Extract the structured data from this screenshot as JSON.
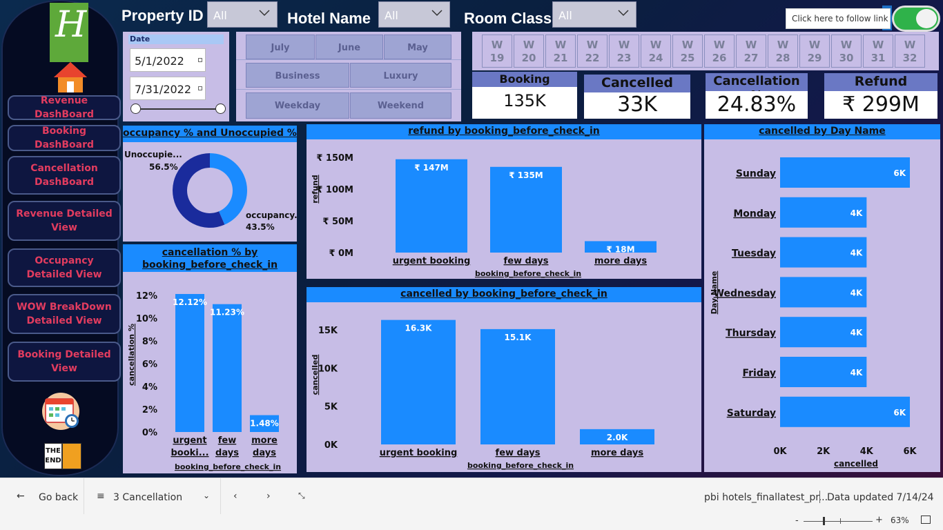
{
  "header": {
    "property_label": "Property ID",
    "property_value": "All",
    "hotel_label": "Hotel Name",
    "hotel_value": "All",
    "room_label": "Room Class",
    "room_value": "All",
    "follow_link_text": "Click here to follow link"
  },
  "sidebar": {
    "logo_letter": "H",
    "logo_icon": "holiday-inn-logo",
    "home_icon": "home-icon",
    "items": [
      {
        "label": "Revenue DashBoard"
      },
      {
        "label": "Booking DashBoard"
      },
      {
        "label": "Cancellation DashBoard"
      },
      {
        "label": "Revenue Detailed View"
      },
      {
        "label": "Occupancy Detailed View"
      },
      {
        "label": "WOW BreakDown Detailed View"
      },
      {
        "label": "Booking Detailed View"
      }
    ],
    "calendar_icon": "calendar-icon",
    "end_icon": "the-end-book-icon",
    "end_text_1": "THE",
    "end_text_2": "END"
  },
  "date_slicer": {
    "label": "Date",
    "start": "5/1/2022",
    "end": "7/31/2022"
  },
  "tiles": {
    "months": [
      "July",
      "June",
      "May"
    ],
    "room_types": [
      "Business",
      "Luxury"
    ],
    "day_types": [
      "Weekday",
      "Weekend"
    ]
  },
  "weeks": [
    {
      "w": "W",
      "n": "19"
    },
    {
      "w": "W",
      "n": "20"
    },
    {
      "w": "W",
      "n": "21"
    },
    {
      "w": "W",
      "n": "22"
    },
    {
      "w": "W",
      "n": "23"
    },
    {
      "w": "W",
      "n": "24"
    },
    {
      "w": "W",
      "n": "25"
    },
    {
      "w": "W",
      "n": "26"
    },
    {
      "w": "W",
      "n": "27"
    },
    {
      "w": "W",
      "n": "28"
    },
    {
      "w": "W",
      "n": "29"
    },
    {
      "w": "W",
      "n": "30"
    },
    {
      "w": "W",
      "n": "31"
    },
    {
      "w": "W",
      "n": "32"
    }
  ],
  "kpis": {
    "booking_label": "Booking",
    "booking_value": "135K",
    "cancelled_label": "Cancelled",
    "cancelled_value": "33K",
    "cancel_pct_label": "Cancellation %",
    "cancel_pct_value": "24.83%",
    "refund_label": "Refund",
    "refund_value": "₹ 299M"
  },
  "colors": {
    "bar": "#1a8bff",
    "donut_dark": "#1a2b9c",
    "donut_light": "#1a8bff",
    "panel": "#c7bde6",
    "nav_text": "#e23c5f"
  },
  "chart_data": [
    {
      "id": "occupancy",
      "type": "pie",
      "title": "occupancy % and Unoccupied %",
      "slices": [
        {
          "label": "Unoccupie...",
          "value": 56.5,
          "display": "56.5%"
        },
        {
          "label": "occupancy...",
          "value": 43.5,
          "display": "43.5%"
        }
      ]
    },
    {
      "id": "refund",
      "type": "bar",
      "title": "refund by booking_before_check_in",
      "xlabel": "booking_before_check_in",
      "ylabel": "refund",
      "categories": [
        "urgent booking",
        "few days",
        "more days"
      ],
      "values": [
        147,
        135,
        18
      ],
      "data_labels": [
        "₹ 147M",
        "₹ 135M",
        "₹ 18M"
      ],
      "yticks": [
        "₹ 0M",
        "₹ 50M",
        "₹ 100M",
        "₹ 150M"
      ],
      "ylim": [
        0,
        150
      ]
    },
    {
      "id": "cancelpct",
      "type": "bar",
      "title": "cancellation % by booking_before_check_in",
      "xlabel": "booking_before_check_in",
      "ylabel": "cancellation %",
      "categories": [
        "urgent booki...",
        "few days",
        "more days"
      ],
      "values": [
        12.12,
        11.23,
        1.48
      ],
      "data_labels": [
        "12.12%",
        "11.23%",
        "1.48%"
      ],
      "yticks": [
        "0%",
        "2%",
        "4%",
        "6%",
        "8%",
        "10%",
        "12%"
      ],
      "ylim": [
        0,
        12
      ]
    },
    {
      "id": "cancelled",
      "type": "bar",
      "title": "cancelled by booking_before_check_in",
      "xlabel": "booking_before_check_in",
      "ylabel": "cancelled",
      "categories": [
        "urgent booking",
        "few days",
        "more days"
      ],
      "values": [
        16.3,
        15.1,
        2.0
      ],
      "data_labels": [
        "16.3K",
        "15.1K",
        "2.0K"
      ],
      "yticks": [
        "0K",
        "5K",
        "10K",
        "15K"
      ],
      "ylim": [
        0,
        15
      ]
    },
    {
      "id": "dayname",
      "type": "bar",
      "title": "cancelled by Day Name",
      "xlabel": "cancelled",
      "ylabel": "Day Name",
      "categories": [
        "Sunday",
        "Monday",
        "Tuesday",
        "Wednesday",
        "Thursday",
        "Friday",
        "Saturday"
      ],
      "values": [
        6,
        4,
        4,
        4,
        4,
        4,
        6
      ],
      "data_labels": [
        "6K",
        "4K",
        "4K",
        "4K",
        "4K",
        "4K",
        "6K"
      ],
      "xticks": [
        "0K",
        "2K",
        "4K",
        "6K"
      ],
      "xlim": [
        0,
        6
      ]
    }
  ],
  "footer": {
    "go_back": "Go back",
    "page_name": "3 Cancellation",
    "report_name": "pbi hotels_finallatest_pr...",
    "data_updated": "Data updated 7/14/24",
    "zoom": "63%",
    "minus": "-",
    "plus": "+"
  }
}
